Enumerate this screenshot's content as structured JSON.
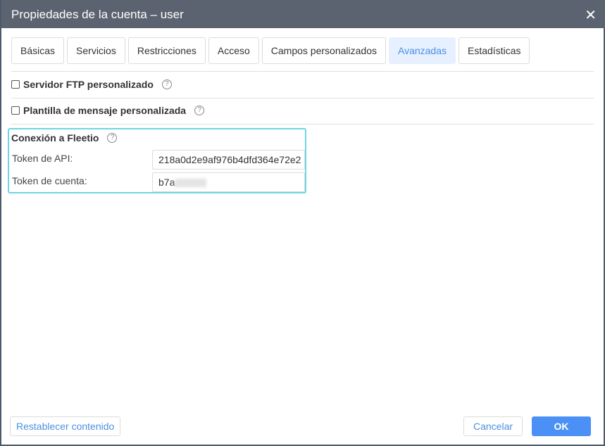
{
  "window": {
    "title": "Propiedades de la cuenta –  user",
    "close": "✕"
  },
  "tabs": [
    {
      "label": "Básicas"
    },
    {
      "label": "Servicios"
    },
    {
      "label": "Restricciones"
    },
    {
      "label": "Acceso"
    },
    {
      "label": "Campos personalizados"
    },
    {
      "label": "Avanzadas",
      "active": true
    },
    {
      "label": "Estadísticas"
    }
  ],
  "options": {
    "ftp": "Servidor FTP personalizado",
    "template": "Plantilla de mensaje personalizada",
    "help": "?"
  },
  "fleetio": {
    "title": "Conexión a Fleetio",
    "api_label": "Token de API:",
    "api_value": "218a0d2e9af976b4dfd364e72e2",
    "account_label": "Token de cuenta:",
    "account_value": "b7a"
  },
  "footer": {
    "reset": "Restablecer contenido",
    "cancel": "Cancelar",
    "ok": "OK"
  },
  "colors": {
    "accent": "#4a90f5",
    "titlebar": "#5c6370",
    "highlight": "#6cd6e6"
  }
}
